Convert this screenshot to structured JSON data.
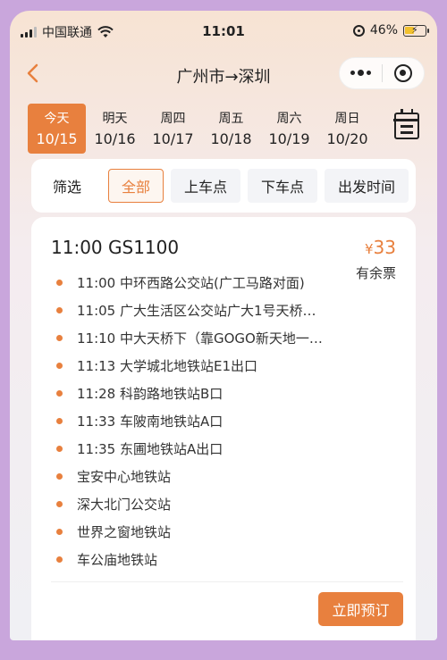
{
  "status_bar": {
    "carrier": "中国联通",
    "time": "11:01",
    "battery": "46%",
    "battery_level": 0.46
  },
  "nav": {
    "title": "广州市→深圳",
    "back_icon": "chevron-left-icon",
    "more_icon": "more-dots-icon",
    "close_icon": "target-close-icon"
  },
  "dates": [
    {
      "weekday": "今天",
      "date": "10/15",
      "active": true
    },
    {
      "weekday": "明天",
      "date": "10/16",
      "active": false
    },
    {
      "weekday": "周四",
      "date": "10/17",
      "active": false
    },
    {
      "weekday": "周五",
      "date": "10/18",
      "active": false
    },
    {
      "weekday": "周六",
      "date": "10/19",
      "active": false
    },
    {
      "weekday": "周日",
      "date": "10/20",
      "active": false
    }
  ],
  "filter": {
    "label": "筛选",
    "options": [
      "全部",
      "上车点",
      "下车点",
      "出发时间"
    ],
    "selected": "全部"
  },
  "trip": {
    "header": "11:00 GS1100",
    "currency": "¥",
    "price": "33",
    "availability": "有余票",
    "stops": [
      "11:00 中环西路公交站(广工马路对面)",
      "11:05 广大生活区公交站广大1号天桥…",
      "11:10 中大天桥下（靠GOGO新天地一…",
      "11:13 大学城北地铁站E1出口",
      "11:28 科韵路地铁站B口",
      "11:33 车陂南地铁站A口",
      "11:35 东圃地铁站A出口",
      "宝安中心地铁站",
      "深大北门公交站",
      "世界之窗地铁站",
      "车公庙地铁站"
    ],
    "book_label": "立即预订"
  },
  "colors": {
    "accent": "#e8803e",
    "frame": "#c9a6dc"
  }
}
